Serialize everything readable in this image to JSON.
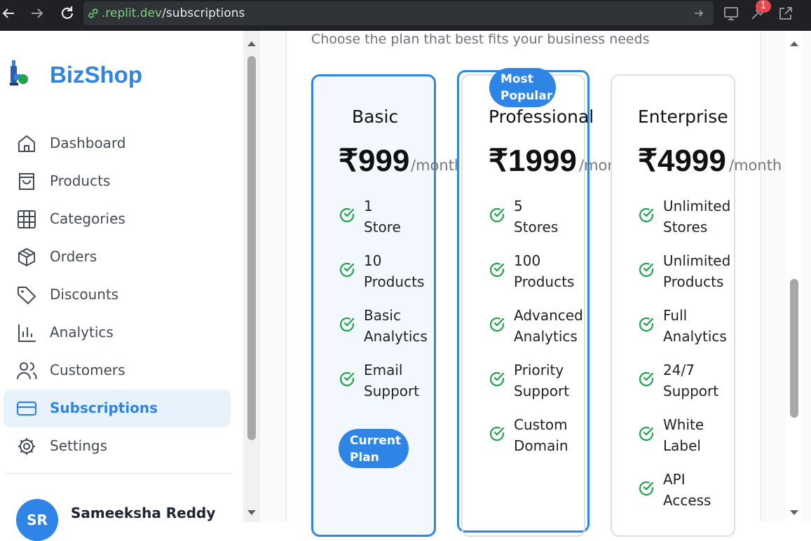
{
  "browser": {
    "url_prefix": ".replit.dev",
    "url_path": "/subscriptions",
    "notification_count": "1"
  },
  "sidebar": {
    "brand": "BizShop",
    "items": [
      {
        "label": "Dashboard",
        "icon": "home-icon"
      },
      {
        "label": "Products",
        "icon": "shopping-bag-icon"
      },
      {
        "label": "Categories",
        "icon": "grid-icon"
      },
      {
        "label": "Orders",
        "icon": "package-icon"
      },
      {
        "label": "Discounts",
        "icon": "tag-icon"
      },
      {
        "label": "Analytics",
        "icon": "bar-chart-icon"
      },
      {
        "label": "Customers",
        "icon": "users-icon"
      },
      {
        "label": "Subscriptions",
        "icon": "credit-card-icon",
        "active": true
      },
      {
        "label": "Settings",
        "icon": "gear-icon"
      }
    ],
    "user": {
      "initials": "SR",
      "name": "Sameeksha Reddy"
    }
  },
  "main": {
    "subtitle": "Choose the plan that best fits your business needs",
    "plans": [
      {
        "name": "Basic",
        "price": "₹999",
        "period": "/month",
        "features": [
          [
            "1",
            "Store"
          ],
          [
            "10",
            "Products"
          ],
          [
            "Basic",
            "Analytics"
          ],
          [
            "Email",
            "Support"
          ]
        ],
        "badge": "Current Plan"
      },
      {
        "name": "Professional",
        "price": "₹1999",
        "period": "/month",
        "tag": "Most Popular",
        "features": [
          [
            "5",
            "Stores"
          ],
          [
            "100",
            "Products"
          ],
          [
            "Advanced",
            "Analytics"
          ],
          [
            "Priority",
            "Support"
          ],
          [
            "Custom",
            "Domain"
          ]
        ]
      },
      {
        "name": "Enterprise",
        "price": "₹4999",
        "period": "/month",
        "features": [
          [
            "Unlimited",
            "Stores"
          ],
          [
            "Unlimited",
            "Products"
          ],
          [
            "Full",
            "Analytics"
          ],
          [
            "24/7",
            "Support"
          ],
          [
            "White",
            "Label"
          ],
          [
            "API",
            "Access"
          ]
        ]
      }
    ]
  },
  "colors": {
    "accent": "#2f85e6",
    "check": "#22a34a"
  }
}
